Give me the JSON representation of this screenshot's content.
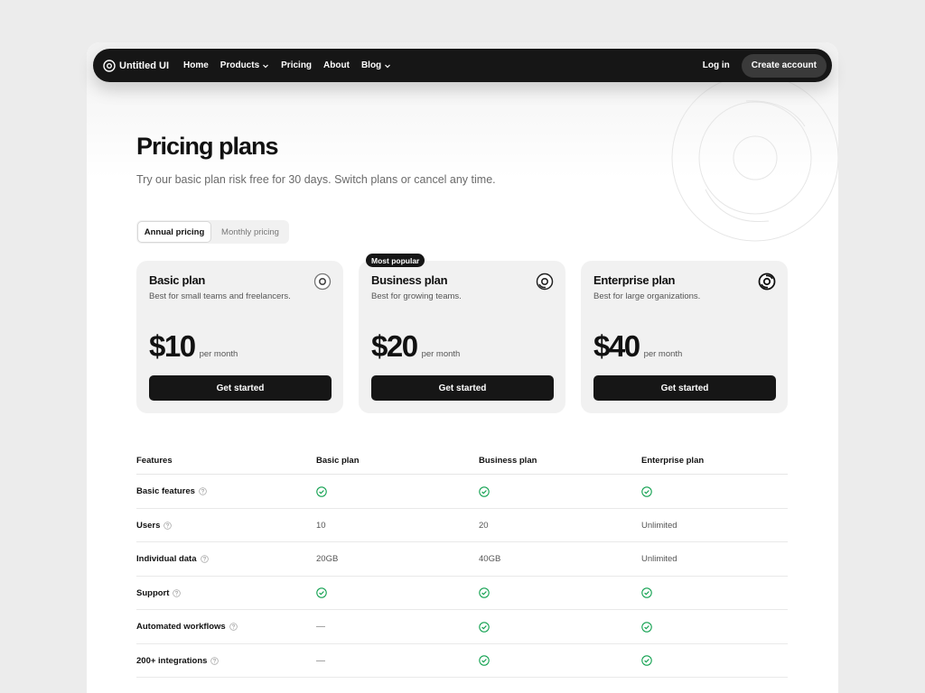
{
  "nav": {
    "brand": "Untitled UI",
    "links": [
      {
        "label": "Home",
        "has_dropdown": false
      },
      {
        "label": "Products",
        "has_dropdown": true
      },
      {
        "label": "Pricing",
        "has_dropdown": false
      },
      {
        "label": "About",
        "has_dropdown": false
      },
      {
        "label": "Blog",
        "has_dropdown": true
      }
    ],
    "login": "Log in",
    "create_account": "Create account"
  },
  "hero": {
    "title": "Pricing plans",
    "subtitle": "Try our basic plan risk free for 30 days. Switch plans or cancel any time."
  },
  "toggle": {
    "annual": "Annual pricing",
    "monthly": "Monthly pricing",
    "selected": "annual"
  },
  "plans": [
    {
      "name": "Basic plan",
      "desc": "Best for small teams and freelancers.",
      "price": "$10",
      "per": "per month",
      "cta": "Get started",
      "icon": "basic-plan-icon"
    },
    {
      "name": "Business plan",
      "desc": "Best for growing teams.",
      "price": "$20",
      "per": "per month",
      "cta": "Get started",
      "icon": "business-plan-icon",
      "badge": "Most popular"
    },
    {
      "name": "Enterprise plan",
      "desc": "Best for large organizations.",
      "price": "$40",
      "per": "per month",
      "cta": "Get started",
      "icon": "enterprise-plan-icon"
    }
  ],
  "table": {
    "headers": [
      "Features",
      "Basic plan",
      "Business plan",
      "Enterprise plan"
    ],
    "rows": [
      {
        "feature": "Basic features",
        "values": [
          "check",
          "check",
          "check"
        ]
      },
      {
        "feature": "Users",
        "values": [
          "10",
          "20",
          "Unlimited"
        ]
      },
      {
        "feature": "Individual data",
        "values": [
          "20GB",
          "40GB",
          "Unlimited"
        ]
      },
      {
        "feature": "Support",
        "values": [
          "check",
          "check",
          "check"
        ]
      },
      {
        "feature": "Automated workflows",
        "values": [
          "—",
          "check",
          "check"
        ]
      },
      {
        "feature": "200+ integrations",
        "values": [
          "—",
          "check",
          "check"
        ]
      }
    ]
  },
  "colors": {
    "accent_dark": "#161616",
    "check_green": "#12a150",
    "card_bg": "#f1f1f1"
  }
}
